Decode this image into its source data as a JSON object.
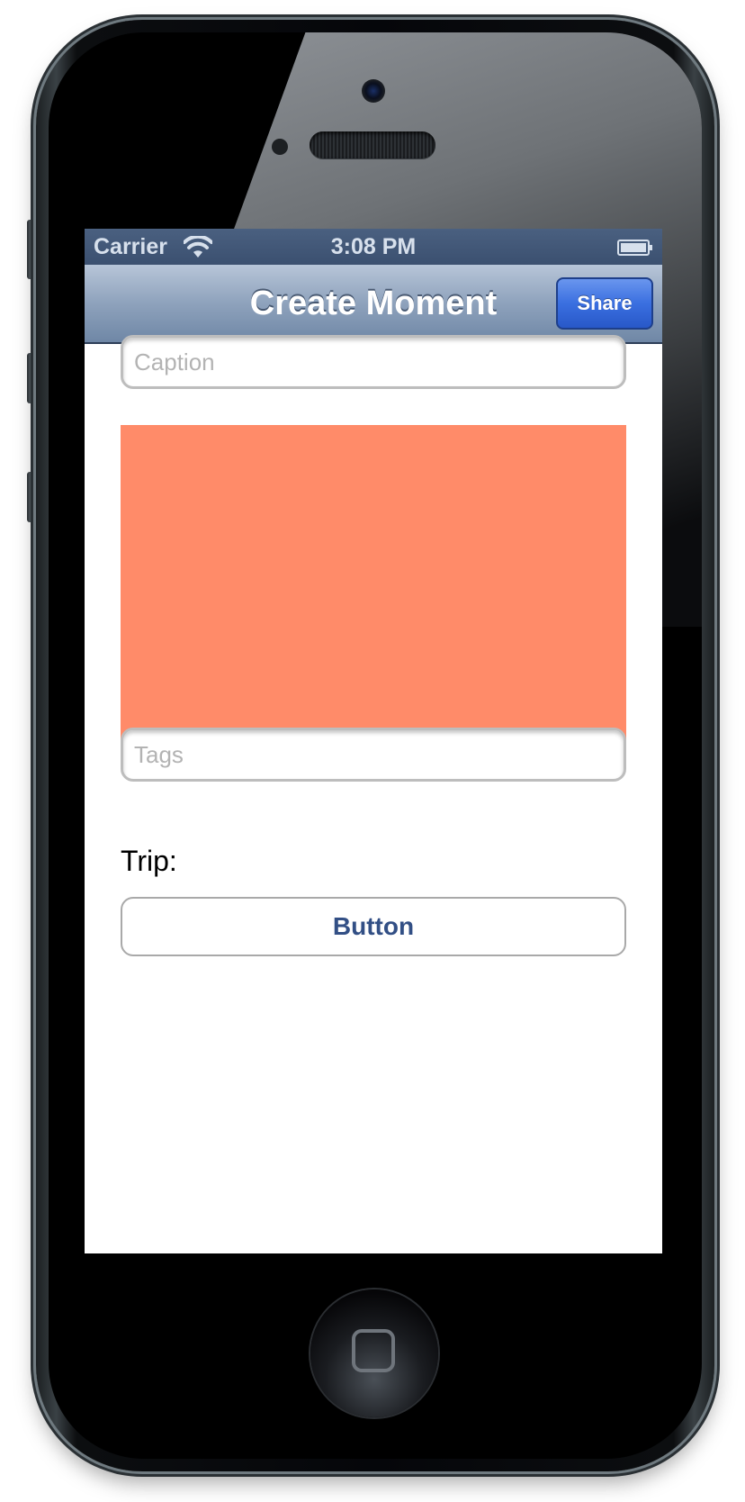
{
  "status_bar": {
    "carrier": "Carrier",
    "time": "3:08 PM"
  },
  "nav_bar": {
    "title": "Create Moment",
    "share_label": "Share"
  },
  "form": {
    "caption_placeholder": "Caption",
    "caption_value": "",
    "tags_placeholder": "Tags",
    "tags_value": "",
    "trip_label": "Trip:",
    "button_label": "Button"
  },
  "colors": {
    "image_placeholder": "#ff8b69",
    "share_button": "#3a6fe0",
    "nav_bar": "#8ea2bc",
    "button_text": "#324f85"
  },
  "icons": {
    "wifi": "wifi-icon",
    "battery": "battery-icon"
  }
}
